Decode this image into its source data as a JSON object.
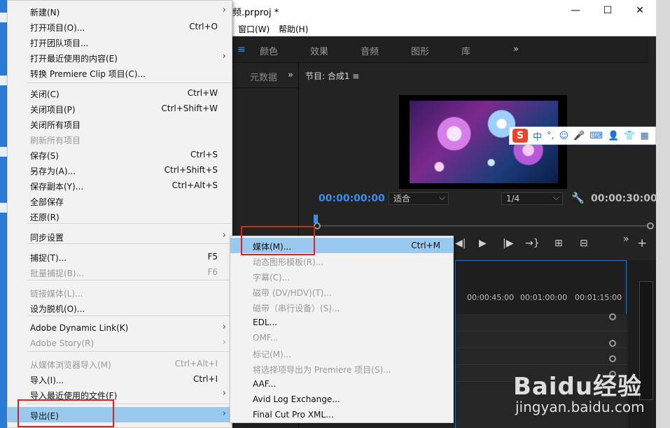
{
  "app": {
    "title": "频.prproj *",
    "win_minimize": "—",
    "win_maximize": "☐",
    "win_close": "✕",
    "menubar": {
      "window": "窗口(W)",
      "help": "帮助(H)"
    }
  },
  "workspace_tabs": {
    "menu": "≡",
    "color": "颜色",
    "effects": "效果",
    "audio": "音频",
    "graphics": "图形",
    "library": "库",
    "more": "»"
  },
  "left_panel": {
    "tab": "元数据",
    "more": "»"
  },
  "program_monitor": {
    "tab": "节目: 合成1  ≡",
    "timecode_current": "00:00:00:00",
    "timecode_duration": "00:00:30:00",
    "fit_select": "适合",
    "resolution_select": "1/4",
    "wrench": "🔧"
  },
  "timeline": {
    "ruler": [
      "00:00:45:00",
      "00:01:00:00",
      "00:01:15:00"
    ]
  },
  "ime": {
    "logo": "S",
    "items": [
      "中",
      "°,",
      "☺",
      "🎤",
      "⌨",
      "👤",
      "👕",
      "▦"
    ]
  },
  "file_menu": {
    "items": [
      {
        "label": "新建(N)",
        "shortcut": "",
        "submenu": true,
        "disabled": false
      },
      {
        "label": "打开项目(O)...",
        "shortcut": "Ctrl+O",
        "submenu": false,
        "disabled": false
      },
      {
        "label": "打开团队项目...",
        "shortcut": "",
        "submenu": false,
        "disabled": false
      },
      {
        "label": "打开最近使用的内容(E)",
        "shortcut": "",
        "submenu": true,
        "disabled": false
      },
      {
        "label": "转换 Premiere Clip 项目(C)...",
        "shortcut": "",
        "submenu": false,
        "disabled": false
      },
      {
        "label": "关闭(C)",
        "shortcut": "Ctrl+W",
        "submenu": false,
        "disabled": false
      },
      {
        "label": "关闭项目(P)",
        "shortcut": "Ctrl+Shift+W",
        "submenu": false,
        "disabled": false
      },
      {
        "label": "关闭所有项目",
        "shortcut": "",
        "submenu": false,
        "disabled": false
      },
      {
        "label": "刷新所有项目",
        "shortcut": "",
        "submenu": false,
        "disabled": true
      },
      {
        "label": "保存(S)",
        "shortcut": "Ctrl+S",
        "submenu": false,
        "disabled": false
      },
      {
        "label": "另存为(A)...",
        "shortcut": "Ctrl+Shift+S",
        "submenu": false,
        "disabled": false
      },
      {
        "label": "保存副本(Y)...",
        "shortcut": "Ctrl+Alt+S",
        "submenu": false,
        "disabled": false
      },
      {
        "label": "全部保存",
        "shortcut": "",
        "submenu": false,
        "disabled": false
      },
      {
        "label": "还原(R)",
        "shortcut": "",
        "submenu": false,
        "disabled": false
      },
      {
        "label": "同步设置",
        "shortcut": "",
        "submenu": true,
        "disabled": false
      },
      {
        "label": "捕捉(T)...",
        "shortcut": "F5",
        "submenu": false,
        "disabled": false
      },
      {
        "label": "批量捕捉(B)...",
        "shortcut": "F6",
        "submenu": false,
        "disabled": true
      },
      {
        "label": "链接媒体(L)...",
        "shortcut": "",
        "submenu": false,
        "disabled": true
      },
      {
        "label": "设为脱机(O)...",
        "shortcut": "",
        "submenu": false,
        "disabled": false
      },
      {
        "label": "Adobe Dynamic Link(K)",
        "shortcut": "",
        "submenu": true,
        "disabled": false
      },
      {
        "label": "Adobe Story(R)",
        "shortcut": "",
        "submenu": true,
        "disabled": true
      },
      {
        "label": "从媒体浏览器导入(M)",
        "shortcut": "Ctrl+Alt+I",
        "submenu": false,
        "disabled": true
      },
      {
        "label": "导入(I)...",
        "shortcut": "Ctrl+I",
        "submenu": false,
        "disabled": false
      },
      {
        "label": "导入最近使用的文件(F)",
        "shortcut": "",
        "submenu": true,
        "disabled": false
      },
      {
        "label": "导出(E)",
        "shortcut": "",
        "submenu": true,
        "disabled": false,
        "highlighted": true
      }
    ]
  },
  "export_menu": {
    "items": [
      {
        "label": "媒体(M)...",
        "shortcut": "Ctrl+M",
        "disabled": false,
        "highlighted": true
      },
      {
        "label": "动态图形模板(R)...",
        "shortcut": "",
        "disabled": true
      },
      {
        "label": "字幕(C)...",
        "shortcut": "",
        "disabled": true
      },
      {
        "label": "磁带 (DV/HDV)(T)...",
        "shortcut": "",
        "disabled": true
      },
      {
        "label": "磁带（串行设备）(S)...",
        "shortcut": "",
        "disabled": true
      },
      {
        "label": "EDL...",
        "shortcut": "",
        "disabled": false
      },
      {
        "label": "OMF...",
        "shortcut": "",
        "disabled": true
      },
      {
        "label": "标记(M)...",
        "shortcut": "",
        "disabled": true
      },
      {
        "label": "将选择项导出为 Premiere 项目(S)...",
        "shortcut": "",
        "disabled": true
      },
      {
        "label": "AAF...",
        "shortcut": "",
        "disabled": false
      },
      {
        "label": "Avid Log Exchange...",
        "shortcut": "",
        "disabled": false
      },
      {
        "label": "Final Cut Pro XML...",
        "shortcut": "",
        "disabled": false
      }
    ]
  },
  "watermark": {
    "brand": "Baidu经验",
    "url": "jingyan.baidu.com"
  },
  "colors": {
    "highlight": "#99c9ef",
    "annotation": "#e02020",
    "timecode_blue": "#3a8ee6"
  }
}
